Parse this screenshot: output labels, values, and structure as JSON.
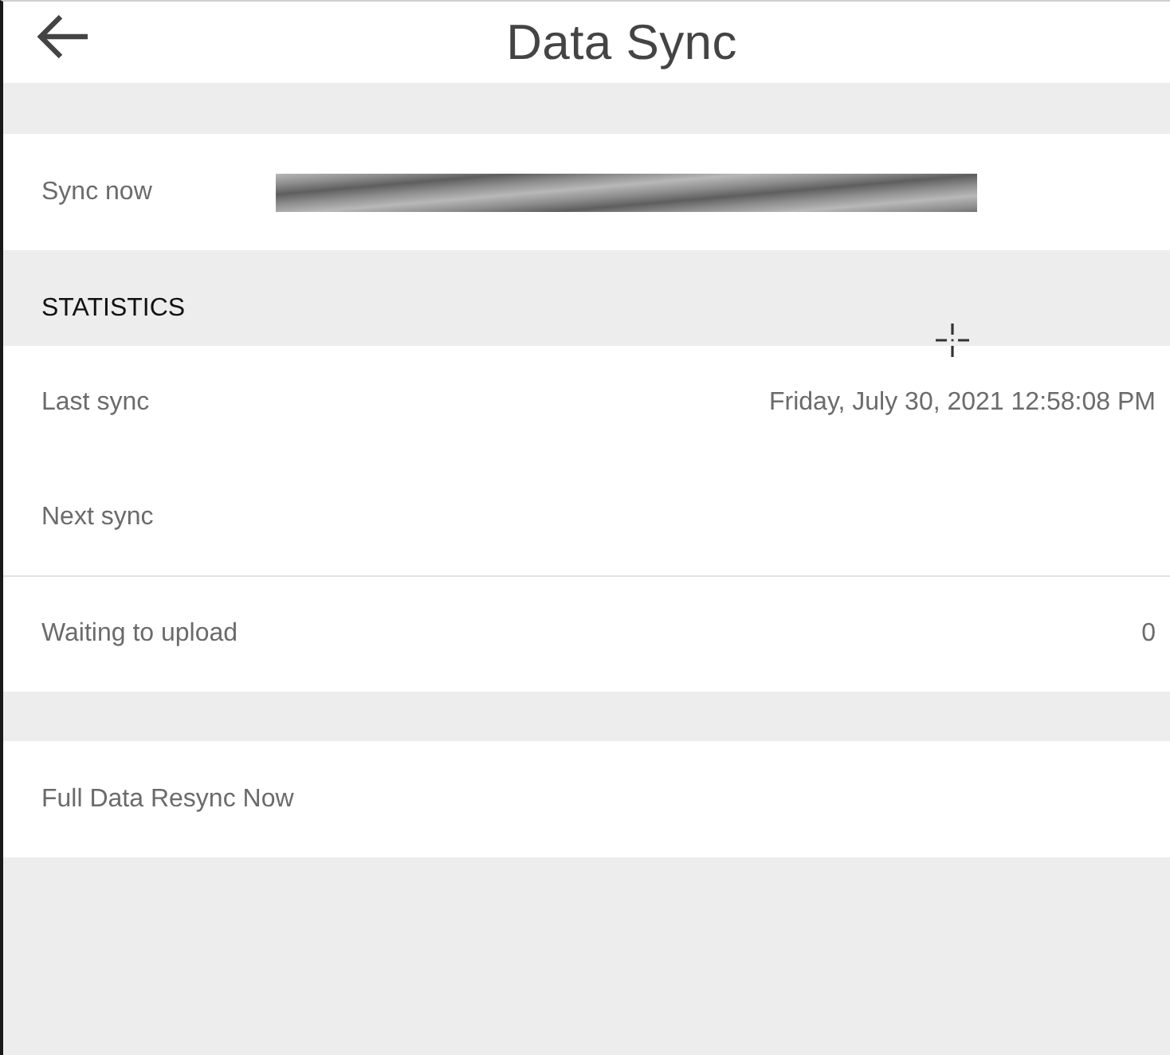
{
  "header": {
    "title": "Data Sync"
  },
  "sync_now": {
    "label": "Sync now",
    "progress": {
      "level": 1,
      "indeterminate": true
    }
  },
  "statistics": {
    "heading": "STATISTICS",
    "rows": [
      {
        "label": "Last sync",
        "value": "Friday, July 30, 2021 12:58:08 PM",
        "divider_below": false
      },
      {
        "label": "Next sync",
        "divider_below": true
      },
      {
        "label": "Waiting to upload",
        "value": "0",
        "divider_below": false
      }
    ]
  },
  "actions": [
    {
      "label": "Full Data Resync Now"
    }
  ]
}
